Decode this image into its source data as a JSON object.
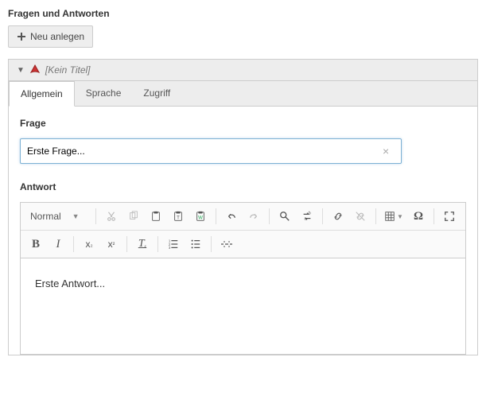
{
  "section": {
    "title": "Fragen und Antworten"
  },
  "buttons": {
    "create": "Neu anlegen"
  },
  "panel": {
    "title": "[Kein Titel]"
  },
  "tabs": {
    "general": "Allgemein",
    "language": "Sprache",
    "access": "Zugriff"
  },
  "fields": {
    "question": {
      "label": "Frage",
      "value": "Erste Frage..."
    },
    "answer": {
      "label": "Antwort",
      "content": "Erste Antwort..."
    }
  },
  "editor": {
    "format_label": "Normal",
    "icons": {
      "cut": "cut",
      "copy": "copy",
      "paste": "paste",
      "pastetext": "paste-text",
      "pasteword": "paste-word",
      "undo": "undo",
      "redo": "redo",
      "find": "find",
      "replace": "replace",
      "link": "link",
      "unlink": "unlink",
      "table": "table",
      "special": "special-char",
      "maximize": "maximize",
      "bold": "bold",
      "italic": "italic",
      "sub": "subscript",
      "sup": "superscript",
      "removeformat": "remove-format",
      "ol": "ordered-list",
      "ul": "unordered-list",
      "pagebreak": "page-break"
    }
  }
}
